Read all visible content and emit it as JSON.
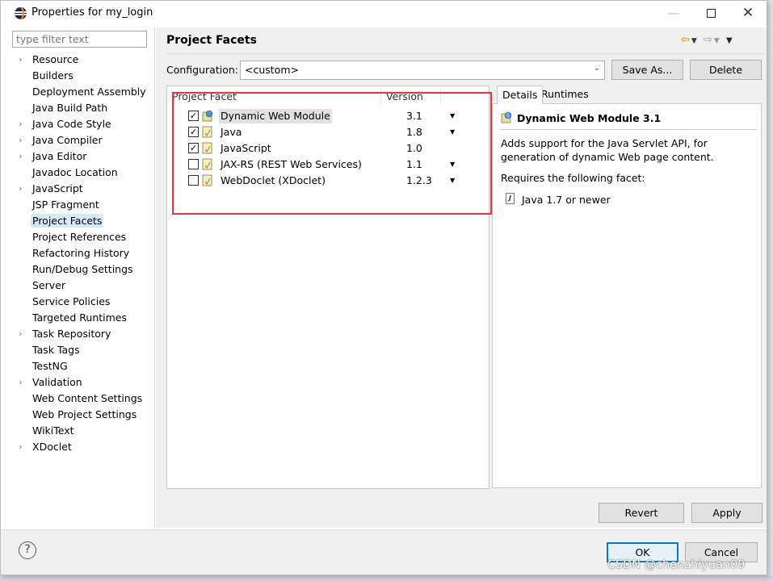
{
  "window": {
    "title": "Properties for my_login"
  },
  "filter": {
    "placeholder": "type filter text"
  },
  "tree": {
    "items": [
      {
        "label": "Resource",
        "expandable": true
      },
      {
        "label": "Builders",
        "expandable": false
      },
      {
        "label": "Deployment Assembly",
        "expandable": false
      },
      {
        "label": "Java Build Path",
        "expandable": false
      },
      {
        "label": "Java Code Style",
        "expandable": true
      },
      {
        "label": "Java Compiler",
        "expandable": true
      },
      {
        "label": "Java Editor",
        "expandable": true
      },
      {
        "label": "Javadoc Location",
        "expandable": false
      },
      {
        "label": "JavaScript",
        "expandable": true
      },
      {
        "label": "JSP Fragment",
        "expandable": false
      },
      {
        "label": "Project Facets",
        "expandable": false,
        "selected": true
      },
      {
        "label": "Project References",
        "expandable": false
      },
      {
        "label": "Refactoring History",
        "expandable": false
      },
      {
        "label": "Run/Debug Settings",
        "expandable": false
      },
      {
        "label": "Server",
        "expandable": false
      },
      {
        "label": "Service Policies",
        "expandable": false
      },
      {
        "label": "Targeted Runtimes",
        "expandable": false
      },
      {
        "label": "Task Repository",
        "expandable": true
      },
      {
        "label": "Task Tags",
        "expandable": false
      },
      {
        "label": "TestNG",
        "expandable": false
      },
      {
        "label": "Validation",
        "expandable": true
      },
      {
        "label": "Web Content Settings",
        "expandable": false
      },
      {
        "label": "Web Project Settings",
        "expandable": false
      },
      {
        "label": "WikiText",
        "expandable": false
      },
      {
        "label": "XDoclet",
        "expandable": true
      }
    ]
  },
  "main": {
    "title": "Project Facets",
    "config_label": "Configuration:",
    "config_value": "<custom>",
    "save_as_label": "Save As...",
    "delete_label": "Delete",
    "columns": {
      "facet": "Project Facet",
      "version": "Version"
    },
    "facets": [
      {
        "name": "Dynamic Web Module",
        "version": "3.1",
        "checked": true,
        "has_dropdown": true,
        "highlighted": true
      },
      {
        "name": "Java",
        "version": "1.8",
        "checked": true,
        "has_dropdown": true
      },
      {
        "name": "JavaScript",
        "version": "1.0",
        "checked": true,
        "has_dropdown": false
      },
      {
        "name": "JAX-RS (REST Web Services)",
        "version": "1.1",
        "checked": false,
        "has_dropdown": true
      },
      {
        "name": "WebDoclet (XDoclet)",
        "version": "1.2.3",
        "checked": false,
        "has_dropdown": true
      }
    ],
    "tabs": {
      "details": "Details",
      "runtimes": "Runtimes"
    },
    "details": {
      "title": "Dynamic Web Module 3.1",
      "description": "Adds support for the Java Servlet API, for generation of dynamic Web page content.",
      "requires": "Requires the following facet:",
      "requirement": "Java 1.7 or newer"
    },
    "revert_label": "Revert",
    "apply_label": "Apply"
  },
  "footer": {
    "help_label": "?",
    "ok_label": "OK",
    "cancel_label": "Cancel"
  },
  "watermark": "CSDN @chenzhiyuan09",
  "colors": {
    "highlight_box": "#e5343a",
    "selection": "#d9e8f7",
    "default_button_border": "#0078d7"
  }
}
